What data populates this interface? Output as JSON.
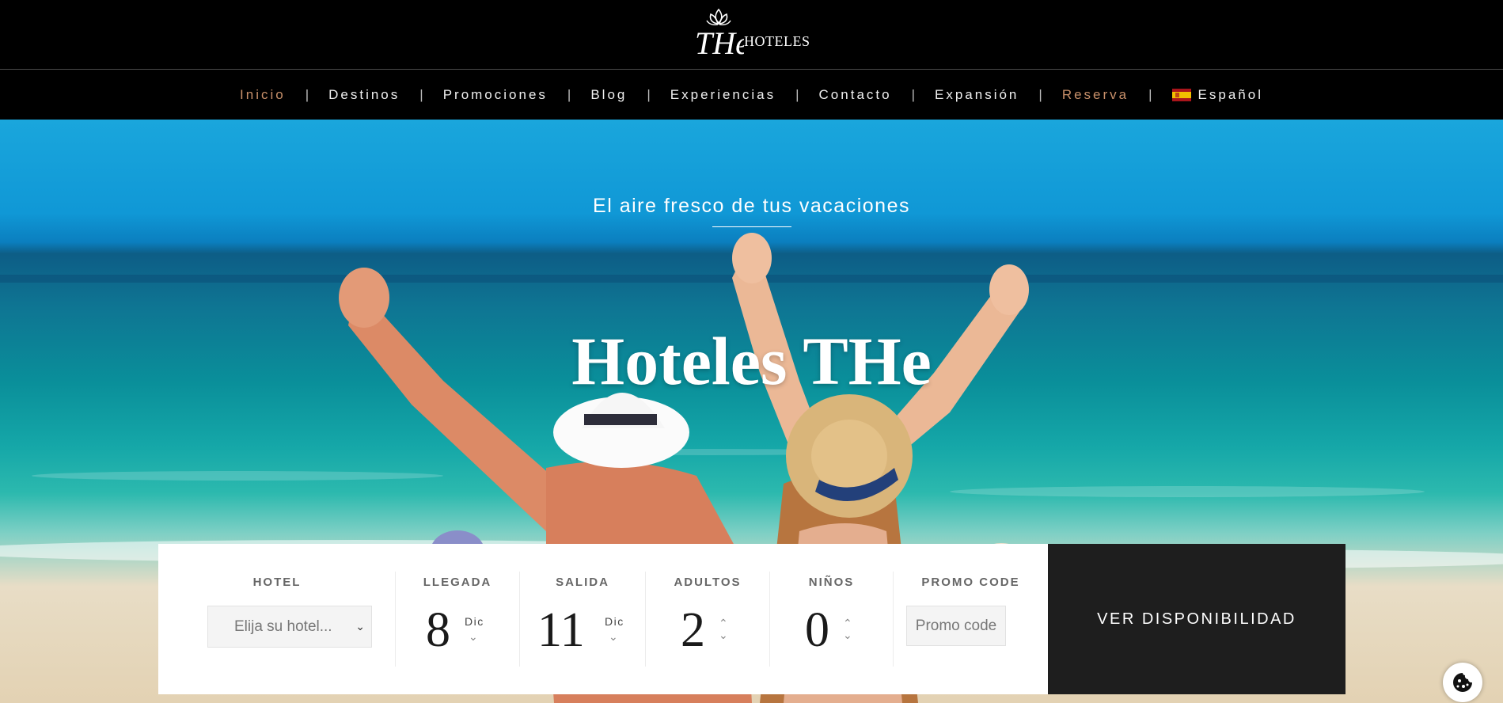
{
  "brand": {
    "logo_text": "HOTELES",
    "logo_mark": "THe"
  },
  "nav": {
    "items": [
      {
        "label": "Inicio",
        "accent": true
      },
      {
        "label": "Destinos",
        "accent": false
      },
      {
        "label": "Promociones",
        "accent": false
      },
      {
        "label": "Blog",
        "accent": false
      },
      {
        "label": "Experiencias",
        "accent": false
      },
      {
        "label": "Contacto",
        "accent": false
      },
      {
        "label": "Expansión",
        "accent": false
      },
      {
        "label": "Reserva",
        "accent": true
      },
      {
        "label": "Español",
        "accent": false,
        "icon": "spain-flag-icon"
      }
    ],
    "separator": "|"
  },
  "hero": {
    "tagline": "El aire fresco de tus vacaciones",
    "title": "Hoteles THe"
  },
  "booking": {
    "hotel": {
      "label": "HOTEL",
      "placeholder": "Elija su hotel..."
    },
    "arrival": {
      "label": "LLEGADA",
      "day": "8",
      "month": "Dic"
    },
    "departure": {
      "label": "SALIDA",
      "day": "11",
      "month": "Dic"
    },
    "adults": {
      "label": "ADULTOS",
      "value": "2"
    },
    "children": {
      "label": "NIÑOS",
      "value": "0"
    },
    "promo": {
      "label": "PROMO CODE",
      "placeholder": "Promo code"
    },
    "cta": "VER DISPONIBILIDAD"
  },
  "colors": {
    "accent": "#c8906a",
    "nav_bg": "#000000",
    "cta_bg": "#1e1e1e"
  }
}
